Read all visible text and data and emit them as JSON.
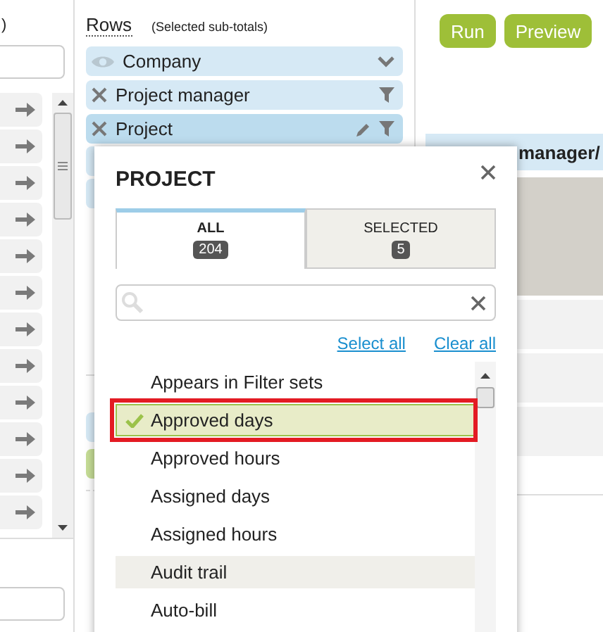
{
  "left_panel": {
    "heading_fragment": ")"
  },
  "rows_panel": {
    "title": "Rows",
    "note": "(Selected sub-totals)",
    "pills": [
      {
        "label": "Company",
        "kind": "visible",
        "selected": false
      },
      {
        "label": "Project manager",
        "kind": "filter",
        "selected": false
      },
      {
        "label": "Project",
        "kind": "edit",
        "selected": true
      }
    ]
  },
  "toolbar": {
    "buttons": [
      "Run",
      "Preview"
    ]
  },
  "table": {
    "header_fragment": "manager/"
  },
  "popup": {
    "title": "PROJECT",
    "tabs": [
      {
        "label": "ALL",
        "count": "204",
        "selected": true
      },
      {
        "label": "SELECTED",
        "count": "5",
        "selected": false
      }
    ],
    "links": [
      "Select all",
      "Clear all"
    ],
    "items": [
      {
        "label": "Appears in Filter sets",
        "selected": false,
        "hovered": false,
        "annotated": false
      },
      {
        "label": "Approved days",
        "selected": true,
        "hovered": false,
        "annotated": true
      },
      {
        "label": "Approved hours",
        "selected": false,
        "hovered": false,
        "annotated": false
      },
      {
        "label": "Assigned days",
        "selected": false,
        "hovered": false,
        "annotated": false
      },
      {
        "label": "Assigned hours",
        "selected": false,
        "hovered": false,
        "annotated": false
      },
      {
        "label": "Audit trail",
        "selected": false,
        "hovered": true,
        "annotated": false
      },
      {
        "label": "Auto-bill",
        "selected": false,
        "hovered": false,
        "annotated": false
      }
    ]
  }
}
